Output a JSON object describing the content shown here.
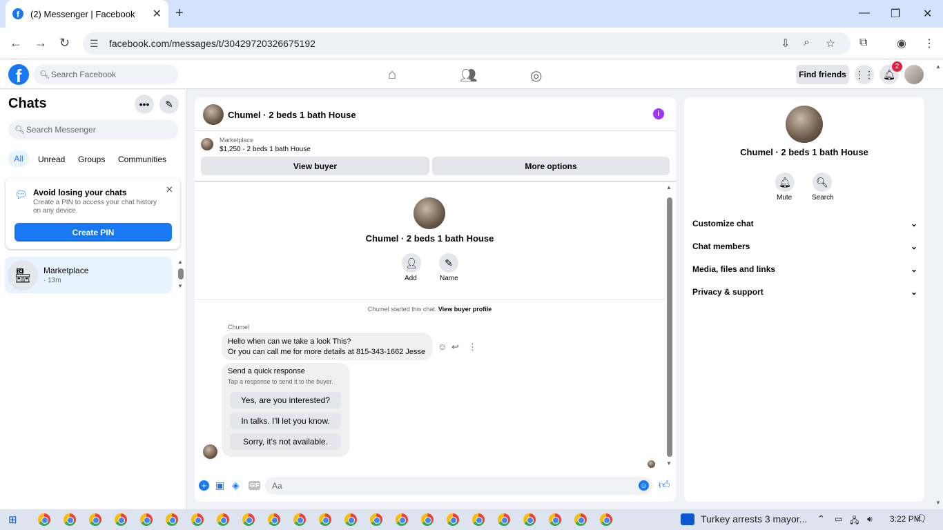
{
  "browser": {
    "tab_title": "(2) Messenger | Facebook",
    "url": "facebook.com/messages/t/30429720326675192",
    "new_tab": "+",
    "close_tab": "✕"
  },
  "header": {
    "search_placeholder": "Search Facebook",
    "find_friends": "Find friends",
    "notification_count": "2"
  },
  "sidebar": {
    "title": "Chats",
    "search_placeholder": "Search Messenger",
    "filters": [
      "All",
      "Unread",
      "Groups",
      "Communities"
    ],
    "pin_card": {
      "title": "Avoid losing your chats",
      "body": "Create a PIN to access your chat history on any device.",
      "button": "Create PIN"
    },
    "chats": [
      {
        "name": "Marketplace",
        "time": "· 13m"
      }
    ]
  },
  "conversation": {
    "title": "Chumel · 2 beds 1 bath House",
    "listing_source": "Marketplace",
    "listing_detail": "$1,250 - 2 beds 1 bath House",
    "view_buyer": "View buyer",
    "more_options": "More options",
    "intro_name": "Chumel · 2 beds 1 bath House",
    "add_label": "Add",
    "name_label": "Name",
    "started_text": "Chumel started this chat.",
    "view_buyer_profile": "View buyer profile",
    "sender": "Chumel",
    "message_line1": "Hello when can we take a look This?",
    "message_line2": "Or you can call me for more details at 815-343-1662 Jesse",
    "quick_title": "Send a quick response",
    "quick_sub": "Tap a response to send it to the buyer.",
    "quick_replies": [
      "Yes, are you interested?",
      "In talks. I'll let you know.",
      "Sorry, it's not available."
    ],
    "composer_placeholder": "Aa",
    "gif_label": "GIF"
  },
  "details": {
    "title": "Chumel · 2 beds 1 bath House",
    "mute": "Mute",
    "search": "Search",
    "sections": [
      "Customize chat",
      "Chat members",
      "Media, files and links",
      "Privacy & support"
    ]
  },
  "taskbar": {
    "news": "Turkey arrests 3 mayor...",
    "time": "3:22 PM"
  },
  "colors": {
    "accent": "#1877f2",
    "info_icon": "#a033ff"
  }
}
